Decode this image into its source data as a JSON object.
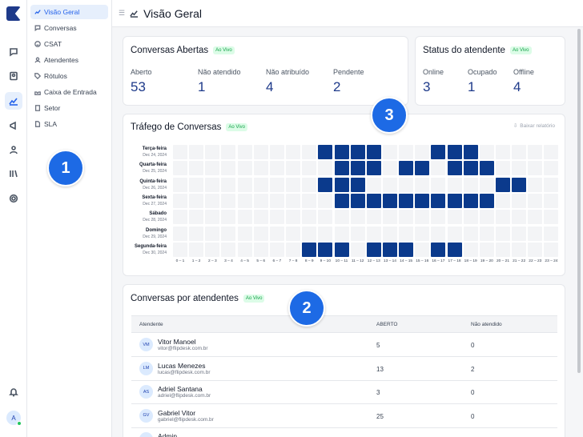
{
  "nav": {
    "items": [
      {
        "label": "Visão Geral",
        "icon": "chart-icon"
      },
      {
        "label": "Conversas",
        "icon": "chat-icon"
      },
      {
        "label": "CSAT",
        "icon": "smile-icon"
      },
      {
        "label": "Atendentes",
        "icon": "users-icon"
      },
      {
        "label": "Rótulos",
        "icon": "tag-icon"
      },
      {
        "label": "Caixa de Entrada",
        "icon": "inbox-icon"
      },
      {
        "label": "Setor",
        "icon": "building-icon"
      },
      {
        "label": "SLA",
        "icon": "document-icon"
      }
    ]
  },
  "header": {
    "title": "Visão Geral"
  },
  "user": {
    "initial": "A"
  },
  "open_conversations": {
    "title": "Conversas Abertas",
    "live": "Ao Vivo",
    "metrics": [
      {
        "label": "Aberto",
        "value": "53"
      },
      {
        "label": "Não atendido",
        "value": "1"
      },
      {
        "label": "Não atribuído",
        "value": "4"
      },
      {
        "label": "Pendente",
        "value": "2"
      }
    ]
  },
  "agent_status": {
    "title": "Status do atendente",
    "live": "Ao Vivo",
    "metrics": [
      {
        "label": "Online",
        "value": "3"
      },
      {
        "label": "Ocupado",
        "value": "1"
      },
      {
        "label": "Offline",
        "value": "4"
      }
    ]
  },
  "traffic": {
    "title": "Tráfego de Conversas",
    "live": "Ao Vivo",
    "report_button": "Baixar relatório",
    "rows": [
      {
        "day": "Terça-feira",
        "date": "Dec 24, 2024",
        "active": [
          9,
          10,
          11,
          12,
          16,
          17,
          18
        ]
      },
      {
        "day": "Quarta-feira",
        "date": "Dec 25, 2024",
        "active": [
          10,
          11,
          12,
          14,
          15,
          17,
          18,
          19
        ]
      },
      {
        "day": "Quinta-feira",
        "date": "Dec 26, 2024",
        "active": [
          9,
          10,
          11,
          20,
          21
        ]
      },
      {
        "day": "Sexta-feira",
        "date": "Dec 27, 2024",
        "active": [
          10,
          11,
          12,
          13,
          14,
          15,
          16,
          17,
          18,
          19
        ]
      },
      {
        "day": "Sábado",
        "date": "Dec 28, 2024",
        "active": []
      },
      {
        "day": "Domingo",
        "date": "Dec 29, 2024",
        "active": []
      },
      {
        "day": "Segunda-feira",
        "date": "Dec 30, 2024",
        "active": [
          8,
          9,
          10,
          12,
          13,
          14,
          16,
          17
        ]
      }
    ],
    "hours": [
      "0 – 1",
      "1 – 2",
      "2 – 3",
      "3 – 4",
      "4 – 5",
      "5 – 6",
      "6 – 7",
      "7 – 8",
      "8 – 9",
      "9 – 10",
      "10 – 11",
      "11 – 12",
      "12 – 13",
      "13 – 14",
      "14 – 15",
      "15 – 16",
      "16 – 17",
      "17 – 18",
      "18 – 19",
      "19 – 20",
      "20 – 21",
      "21 – 22",
      "22 – 23",
      "23 – 24"
    ]
  },
  "agents_table": {
    "title": "Conversas por atendentes",
    "live": "Ao Vivo",
    "columns": [
      "Atendente",
      "ABERTO",
      "Não atendido"
    ],
    "rows": [
      {
        "initials": "VM",
        "name": "Vitor Manoel",
        "email": "vitor@flipdesk.com.br",
        "open": "5",
        "unattended": "0"
      },
      {
        "initials": "LM",
        "name": "Lucas Menezes",
        "email": "lucas@flipdesk.com.br",
        "open": "13",
        "unattended": "2"
      },
      {
        "initials": "AS",
        "name": "Adriel Santana",
        "email": "adriel@flipdesk.com.br",
        "open": "3",
        "unattended": "0"
      },
      {
        "initials": "GV",
        "name": "Gabriel Vitor",
        "email": "gabriel@flipdesk.com.br",
        "open": "25",
        "unattended": "0"
      },
      {
        "initials": "",
        "name": "Admin",
        "email": "",
        "open": "",
        "unattended": ""
      }
    ]
  },
  "badges": [
    "1",
    "2",
    "3"
  ]
}
